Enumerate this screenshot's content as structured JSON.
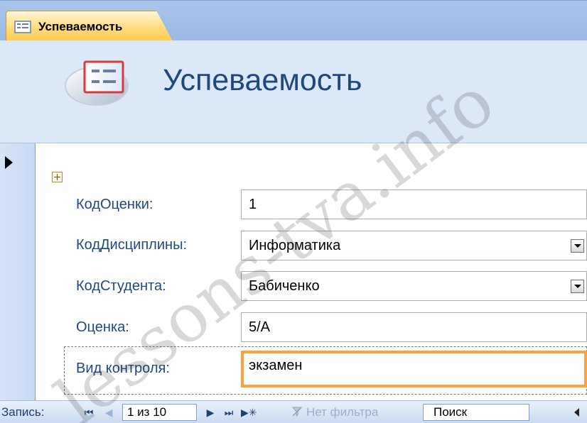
{
  "tab": {
    "label": "Успеваемость",
    "icon": "form-icon"
  },
  "header": {
    "title": "Успеваемость",
    "logo_icon": "form-logo-icon"
  },
  "record_selector": {
    "icon": "current-record-arrow-icon"
  },
  "form": {
    "fields": [
      {
        "label": "КодОценки:",
        "value": "1",
        "control": "textbox"
      },
      {
        "label": "КодДисциплины:",
        "value": "Информатика",
        "control": "combobox"
      },
      {
        "label": "КодСтудента:",
        "value": "Бабиченко",
        "control": "combobox"
      },
      {
        "label": "Оценка:",
        "value": "5/А",
        "control": "textbox"
      },
      {
        "label": "Вид контроля:",
        "value": "экзамен",
        "control": "textbox",
        "focused": true
      }
    ]
  },
  "navigation": {
    "label": "Запись:",
    "record_counter": "1 из 10",
    "filter_status": "Нет фильтра",
    "search_placeholder": "Поиск",
    "icons": [
      "first-record-icon",
      "previous-record-icon",
      "next-record-icon",
      "last-record-icon",
      "new-record-icon",
      "filter-icon",
      "scroll-left-icon"
    ]
  },
  "watermark": {
    "text": "lessons-tva.info"
  },
  "colors": {
    "tab_background": "#ffd36c",
    "header_background": "#dbe8f8",
    "label_text": "#1f497d",
    "focus_border": "#f6a540",
    "navbar_background": "#d9e7f8"
  }
}
